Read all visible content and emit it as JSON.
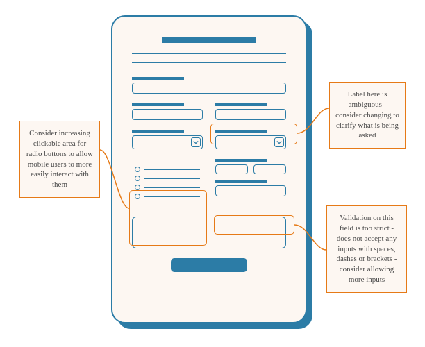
{
  "annotations": {
    "left": "Consider increasing clickable area for radio buttons to allow mobile users to more easily interact with them",
    "topRight": "Label here is ambiguous - consider changing to clarify what is being asked",
    "bottomRight": "Validation on this field is too strict - does not accept any inputs with spaces, dashes or brackets - consider allowing more inputs"
  }
}
